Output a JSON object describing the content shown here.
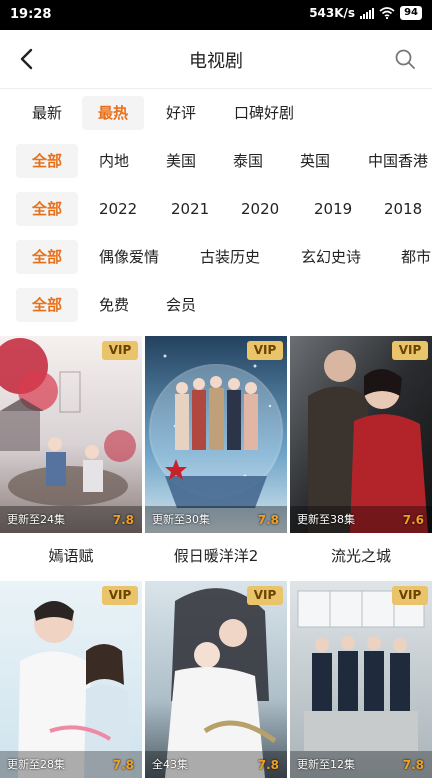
{
  "status": {
    "time": "19:28",
    "speed": "543K/s",
    "battery": "94"
  },
  "nav": {
    "title": "电视剧"
  },
  "filters": {
    "sort": [
      "最新",
      "最热",
      "好评",
      "口碑好剧"
    ],
    "region": [
      "全部",
      "内地",
      "美国",
      "泰国",
      "英国",
      "中国香港"
    ],
    "year": [
      "全部",
      "2022",
      "2021",
      "2020",
      "2019",
      "2018"
    ],
    "genre": [
      "全部",
      "偶像爱情",
      "古装历史",
      "玄幻史诗",
      "都市"
    ],
    "pay": [
      "全部",
      "免费",
      "会员"
    ]
  },
  "shows": [
    {
      "title": "嫣语赋",
      "vip": "VIP",
      "update": "更新至24集",
      "score": "7.8"
    },
    {
      "title": "假日暖洋洋2",
      "vip": "VIP",
      "update": "更新至30集",
      "score": "7.8"
    },
    {
      "title": "流光之城",
      "vip": "VIP",
      "update": "更新至38集",
      "score": "7.6"
    },
    {
      "title": "",
      "vip": "VIP",
      "update": "更新至28集",
      "score": "7.8"
    },
    {
      "title": "",
      "vip": "VIP",
      "update": "全43集",
      "score": "7.8"
    },
    {
      "title": "",
      "vip": "VIP",
      "update": "更新至12集",
      "score": "7.8"
    }
  ],
  "colors": {
    "accent": "#e8701a",
    "vip": "#e9c46a",
    "score": "#f0a020"
  }
}
